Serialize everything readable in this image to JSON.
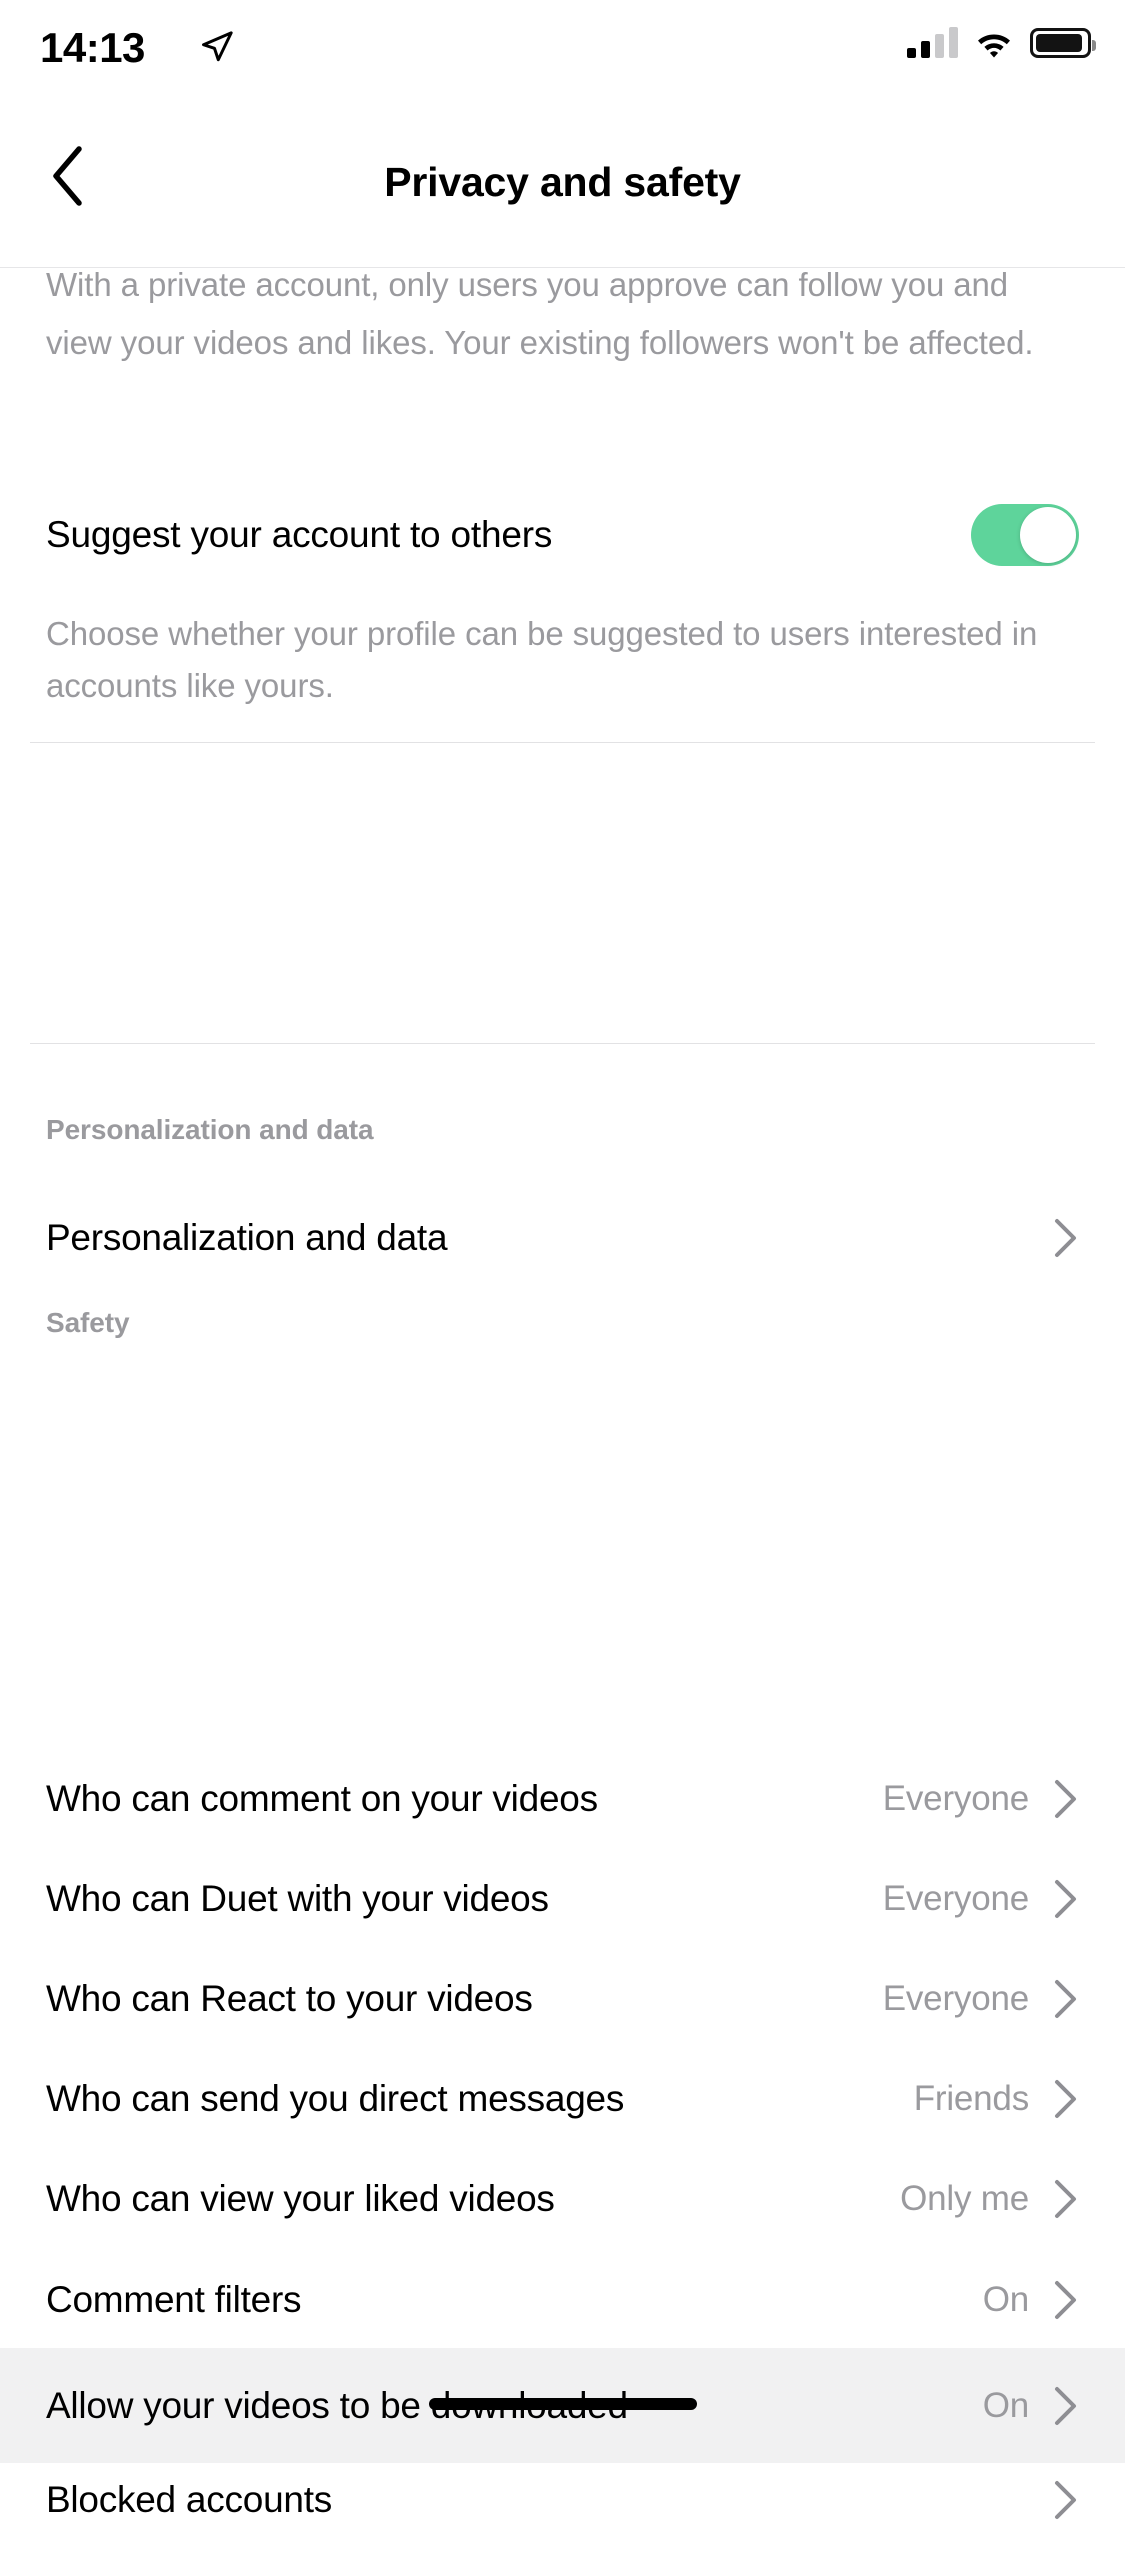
{
  "status_bar": {
    "time": "14:13",
    "location_icon": "location-arrow-icon",
    "signal_icon": "cellular-signal-icon",
    "wifi_icon": "wifi-icon",
    "battery_icon": "battery-icon"
  },
  "header": {
    "back_icon": "chevron-left-icon",
    "title": "Privacy and safety"
  },
  "private_account": {
    "description": "With a private account, only users you approve can follow you and view your videos and likes. Your existing followers won't be affected."
  },
  "suggest_account": {
    "label": "Suggest your account to others",
    "description": "Choose whether your profile can be suggested to users interested in accounts like yours.",
    "toggle_state": "on",
    "toggle_color": "#5ed49b"
  },
  "sections": [
    {
      "header": "Personalization and data",
      "rows": [
        {
          "label": "Personalization and data",
          "value": "",
          "chevron": "chevron-right-icon"
        }
      ]
    },
    {
      "header": "Safety",
      "rows": [
        {
          "label": "Who can comment on your videos",
          "value": "Everyone",
          "chevron": "chevron-right-icon"
        },
        {
          "label": "Who can Duet with your videos",
          "value": "Everyone",
          "chevron": "chevron-right-icon"
        },
        {
          "label": "Who can React to your videos",
          "value": "Everyone",
          "chevron": "chevron-right-icon"
        },
        {
          "label": "Who can send you direct messages",
          "value": "Friends",
          "chevron": "chevron-right-icon"
        },
        {
          "label": "Who can view your liked videos",
          "value": "Only me",
          "chevron": "chevron-right-icon"
        },
        {
          "label": "Comment filters",
          "value": "On",
          "chevron": "chevron-right-icon"
        },
        {
          "label": "Allow your videos to be downloaded",
          "value": "On",
          "chevron": "chevron-right-icon",
          "highlighted": true
        },
        {
          "label": "Blocked accounts",
          "value": "",
          "chevron": "chevron-right-icon"
        }
      ]
    }
  ],
  "colors": {
    "accent_green": "#5ed49b",
    "secondary_text": "#9a9a9e",
    "divider": "#e2e2e4",
    "row_highlight": "#f1f1f2"
  }
}
